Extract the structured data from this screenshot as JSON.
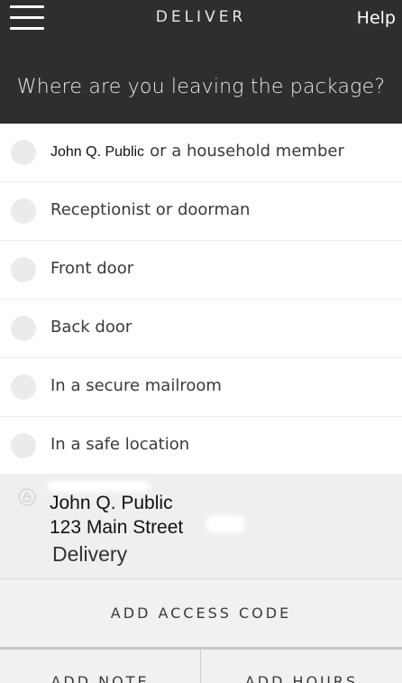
{
  "header": {
    "title": "DELIVER",
    "help_label": "Help",
    "question": "Where are you leaving the package?"
  },
  "options": [
    {
      "name": "John Q. Public",
      "label": "or a household member"
    },
    {
      "label": "Receptionist or doorman"
    },
    {
      "label": "Front door"
    },
    {
      "label": "Back door"
    },
    {
      "label": "In a secure mailroom"
    },
    {
      "label": "In a safe location"
    }
  ],
  "address": {
    "name": "John Q. Public",
    "street": "123 Main Street",
    "type": "Delivery"
  },
  "actions": {
    "access_code": "ADD ACCESS CODE",
    "note": "ADD NOTE",
    "hours": "ADD HOURS"
  },
  "colors": {
    "header_bg": "#2f2e2c",
    "address_bg": "#efefef"
  }
}
